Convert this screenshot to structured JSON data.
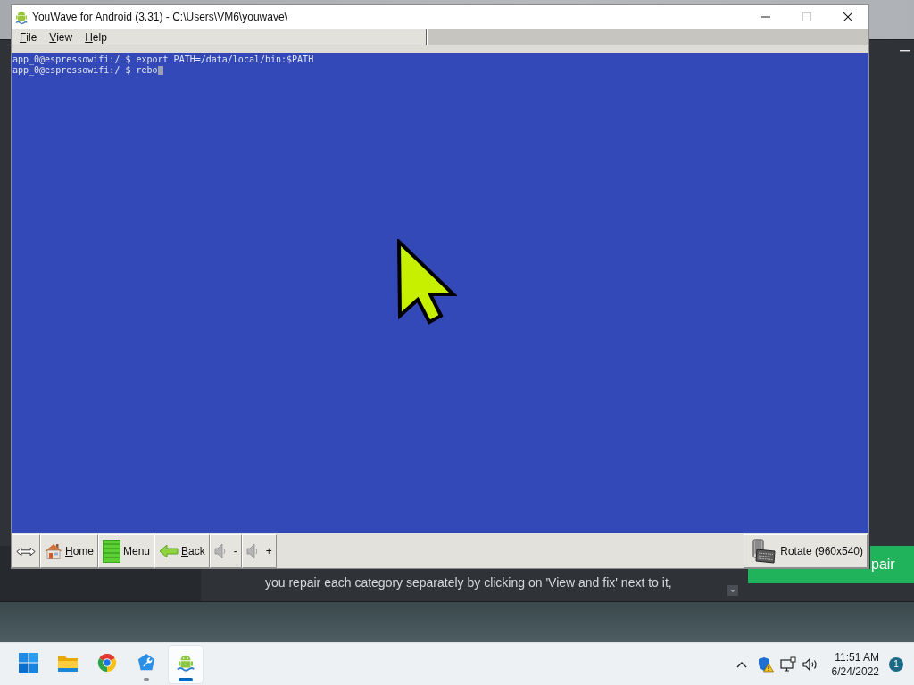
{
  "background_window": {
    "description": "you repair each category separately by clicking on 'View and fix' next to it,",
    "button": {
      "label": "pair"
    }
  },
  "window": {
    "title": "YouWave for Android (3.31) - C:\\Users\\VM6\\youwave\\",
    "controls": [
      {
        "kind": "minimize",
        "disabled": false
      },
      {
        "kind": "maximize",
        "disabled": true
      },
      {
        "kind": "close",
        "disabled": false
      }
    ]
  },
  "menu": [
    {
      "label": "File",
      "mnemonic": true
    },
    {
      "label": "View",
      "mnemonic": true
    },
    {
      "label": "Help",
      "mnemonic": true
    }
  ],
  "terminal": {
    "lines": [
      "app_0@espressowifi:/ $ export PATH=/data/local/bin:$PATH",
      "app_0@espressowifi:/ $ rebo"
    ],
    "cursor": true
  },
  "toolbar": {
    "buttons": [
      {
        "kind": "home",
        "label": "Home",
        "mnemonic": true
      },
      {
        "kind": "menu",
        "label": "Menu",
        "mnemonic": false
      },
      {
        "kind": "back",
        "label": "Back",
        "mnemonic": true
      },
      {
        "kind": "volume",
        "label": "-",
        "mnemonic": false
      },
      {
        "kind": "volume",
        "label": "+",
        "mnemonic": false
      }
    ],
    "rotate": {
      "label": "Rotate (960x540)"
    }
  },
  "taskbar": {
    "apps": [
      {
        "kind": "start",
        "running": false,
        "active": false
      },
      {
        "kind": "files",
        "running": false,
        "active": false
      },
      {
        "kind": "browser",
        "running": false,
        "active": false
      },
      {
        "kind": "tool",
        "running": true,
        "active": false
      },
      {
        "kind": "emulator",
        "running": true,
        "active": true
      }
    ],
    "time": "11:51 AM",
    "date": "6/24/2022",
    "notifications": "1"
  }
}
